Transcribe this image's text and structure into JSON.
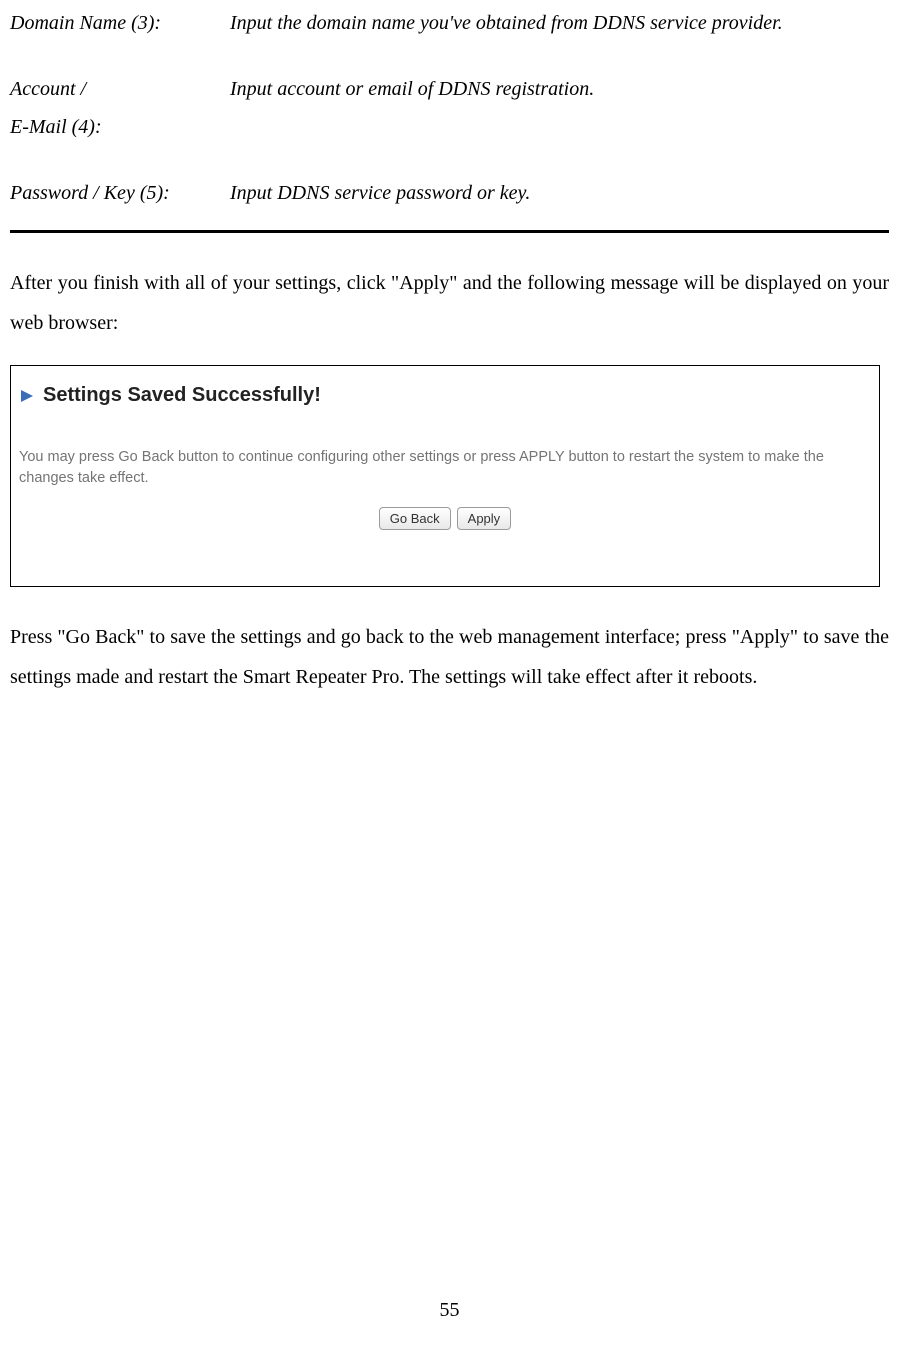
{
  "defs": {
    "row1": {
      "label": "Domain Name (3):",
      "desc": "Input the domain name you've obtained from DDNS service provider."
    },
    "row2": {
      "label1": "Account /",
      "label2": "E-Mail (4):",
      "desc": "Input account or email of DDNS registration."
    },
    "row3": {
      "label": "Password / Key (5):",
      "desc": "Input DDNS service password or key."
    }
  },
  "para1": "After you finish with all of your settings, click \"Apply\" and the following message will be displayed on your web browser:",
  "panel": {
    "title": "Settings Saved Successfully!",
    "message": "You may press Go Back button to continue configuring other settings or press APPLY button to restart the system to make the changes take effect.",
    "buttons": {
      "goback": "Go Back",
      "apply": "Apply"
    }
  },
  "para2": "Press \"Go Back\" to save the settings and go back to the web management interface; press \"Apply\" to save the settings made and restart the Smart Repeater Pro.    The settings will take effect after it reboots.",
  "page_number": "55"
}
